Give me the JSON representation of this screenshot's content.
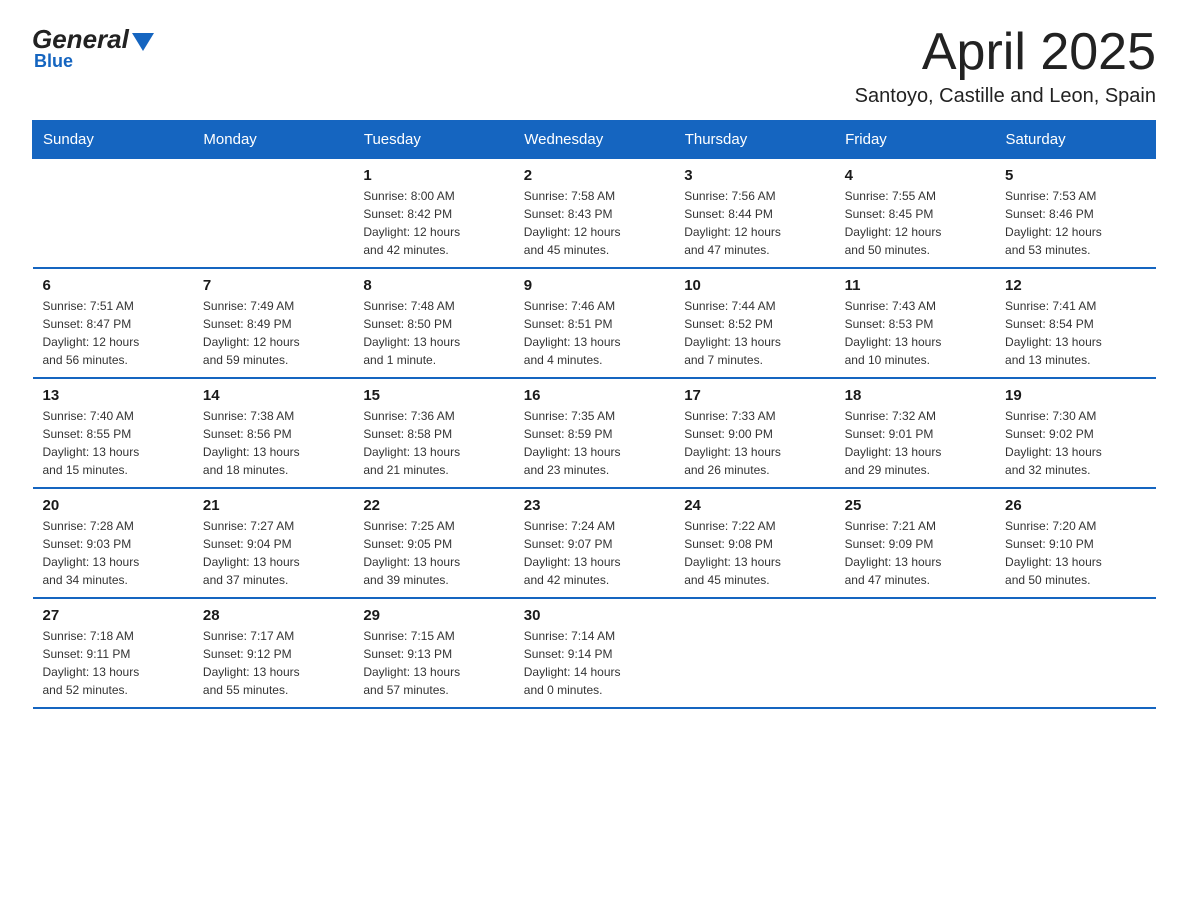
{
  "header": {
    "logo_text1": "General",
    "logo_text2": "Blue",
    "month_title": "April 2025",
    "subtitle": "Santoyo, Castille and Leon, Spain"
  },
  "calendar": {
    "days_of_week": [
      "Sunday",
      "Monday",
      "Tuesday",
      "Wednesday",
      "Thursday",
      "Friday",
      "Saturday"
    ],
    "weeks": [
      [
        {
          "day": "",
          "info": ""
        },
        {
          "day": "",
          "info": ""
        },
        {
          "day": "1",
          "info": "Sunrise: 8:00 AM\nSunset: 8:42 PM\nDaylight: 12 hours\nand 42 minutes."
        },
        {
          "day": "2",
          "info": "Sunrise: 7:58 AM\nSunset: 8:43 PM\nDaylight: 12 hours\nand 45 minutes."
        },
        {
          "day": "3",
          "info": "Sunrise: 7:56 AM\nSunset: 8:44 PM\nDaylight: 12 hours\nand 47 minutes."
        },
        {
          "day": "4",
          "info": "Sunrise: 7:55 AM\nSunset: 8:45 PM\nDaylight: 12 hours\nand 50 minutes."
        },
        {
          "day": "5",
          "info": "Sunrise: 7:53 AM\nSunset: 8:46 PM\nDaylight: 12 hours\nand 53 minutes."
        }
      ],
      [
        {
          "day": "6",
          "info": "Sunrise: 7:51 AM\nSunset: 8:47 PM\nDaylight: 12 hours\nand 56 minutes."
        },
        {
          "day": "7",
          "info": "Sunrise: 7:49 AM\nSunset: 8:49 PM\nDaylight: 12 hours\nand 59 minutes."
        },
        {
          "day": "8",
          "info": "Sunrise: 7:48 AM\nSunset: 8:50 PM\nDaylight: 13 hours\nand 1 minute."
        },
        {
          "day": "9",
          "info": "Sunrise: 7:46 AM\nSunset: 8:51 PM\nDaylight: 13 hours\nand 4 minutes."
        },
        {
          "day": "10",
          "info": "Sunrise: 7:44 AM\nSunset: 8:52 PM\nDaylight: 13 hours\nand 7 minutes."
        },
        {
          "day": "11",
          "info": "Sunrise: 7:43 AM\nSunset: 8:53 PM\nDaylight: 13 hours\nand 10 minutes."
        },
        {
          "day": "12",
          "info": "Sunrise: 7:41 AM\nSunset: 8:54 PM\nDaylight: 13 hours\nand 13 minutes."
        }
      ],
      [
        {
          "day": "13",
          "info": "Sunrise: 7:40 AM\nSunset: 8:55 PM\nDaylight: 13 hours\nand 15 minutes."
        },
        {
          "day": "14",
          "info": "Sunrise: 7:38 AM\nSunset: 8:56 PM\nDaylight: 13 hours\nand 18 minutes."
        },
        {
          "day": "15",
          "info": "Sunrise: 7:36 AM\nSunset: 8:58 PM\nDaylight: 13 hours\nand 21 minutes."
        },
        {
          "day": "16",
          "info": "Sunrise: 7:35 AM\nSunset: 8:59 PM\nDaylight: 13 hours\nand 23 minutes."
        },
        {
          "day": "17",
          "info": "Sunrise: 7:33 AM\nSunset: 9:00 PM\nDaylight: 13 hours\nand 26 minutes."
        },
        {
          "day": "18",
          "info": "Sunrise: 7:32 AM\nSunset: 9:01 PM\nDaylight: 13 hours\nand 29 minutes."
        },
        {
          "day": "19",
          "info": "Sunrise: 7:30 AM\nSunset: 9:02 PM\nDaylight: 13 hours\nand 32 minutes."
        }
      ],
      [
        {
          "day": "20",
          "info": "Sunrise: 7:28 AM\nSunset: 9:03 PM\nDaylight: 13 hours\nand 34 minutes."
        },
        {
          "day": "21",
          "info": "Sunrise: 7:27 AM\nSunset: 9:04 PM\nDaylight: 13 hours\nand 37 minutes."
        },
        {
          "day": "22",
          "info": "Sunrise: 7:25 AM\nSunset: 9:05 PM\nDaylight: 13 hours\nand 39 minutes."
        },
        {
          "day": "23",
          "info": "Sunrise: 7:24 AM\nSunset: 9:07 PM\nDaylight: 13 hours\nand 42 minutes."
        },
        {
          "day": "24",
          "info": "Sunrise: 7:22 AM\nSunset: 9:08 PM\nDaylight: 13 hours\nand 45 minutes."
        },
        {
          "day": "25",
          "info": "Sunrise: 7:21 AM\nSunset: 9:09 PM\nDaylight: 13 hours\nand 47 minutes."
        },
        {
          "day": "26",
          "info": "Sunrise: 7:20 AM\nSunset: 9:10 PM\nDaylight: 13 hours\nand 50 minutes."
        }
      ],
      [
        {
          "day": "27",
          "info": "Sunrise: 7:18 AM\nSunset: 9:11 PM\nDaylight: 13 hours\nand 52 minutes."
        },
        {
          "day": "28",
          "info": "Sunrise: 7:17 AM\nSunset: 9:12 PM\nDaylight: 13 hours\nand 55 minutes."
        },
        {
          "day": "29",
          "info": "Sunrise: 7:15 AM\nSunset: 9:13 PM\nDaylight: 13 hours\nand 57 minutes."
        },
        {
          "day": "30",
          "info": "Sunrise: 7:14 AM\nSunset: 9:14 PM\nDaylight: 14 hours\nand 0 minutes."
        },
        {
          "day": "",
          "info": ""
        },
        {
          "day": "",
          "info": ""
        },
        {
          "day": "",
          "info": ""
        }
      ]
    ]
  }
}
